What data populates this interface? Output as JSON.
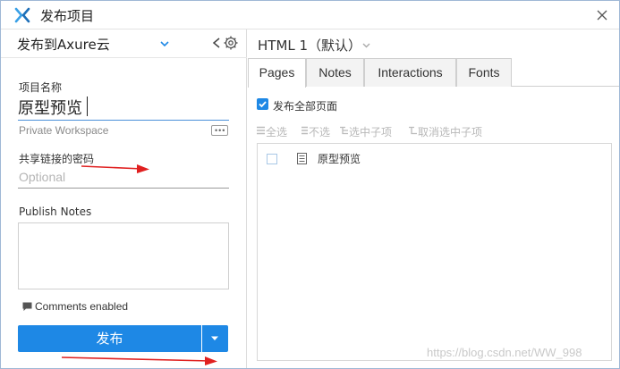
{
  "window": {
    "title": "发布项目",
    "accent_color": "#1e88e5",
    "annotation_color": "#e02020"
  },
  "left_panel": {
    "publish_target": "发布到Axure云",
    "project_name_label": "项目名称",
    "project_name_value": "原型预览",
    "workspace": "Private Workspace",
    "password_label": "共享链接的密码",
    "password_placeholder": "Optional",
    "notes_label": "Publish Notes",
    "comments_label": "Comments enabled",
    "publish_button": "发布"
  },
  "right_panel": {
    "format": "HTML 1（默认）",
    "tabs": [
      {
        "label": "Pages",
        "active": true
      },
      {
        "label": "Notes",
        "active": false
      },
      {
        "label": "Interactions",
        "active": false
      },
      {
        "label": "Fonts",
        "active": false
      }
    ],
    "publish_all_label": "发布全部页面",
    "publish_all_checked": true,
    "toolbar": [
      "全选",
      "不选",
      "选中子项",
      "取消选中子项"
    ],
    "pages": [
      {
        "name": "原型预览",
        "checked": false
      }
    ]
  },
  "watermark": "https://blog.csdn.net/WW_998"
}
